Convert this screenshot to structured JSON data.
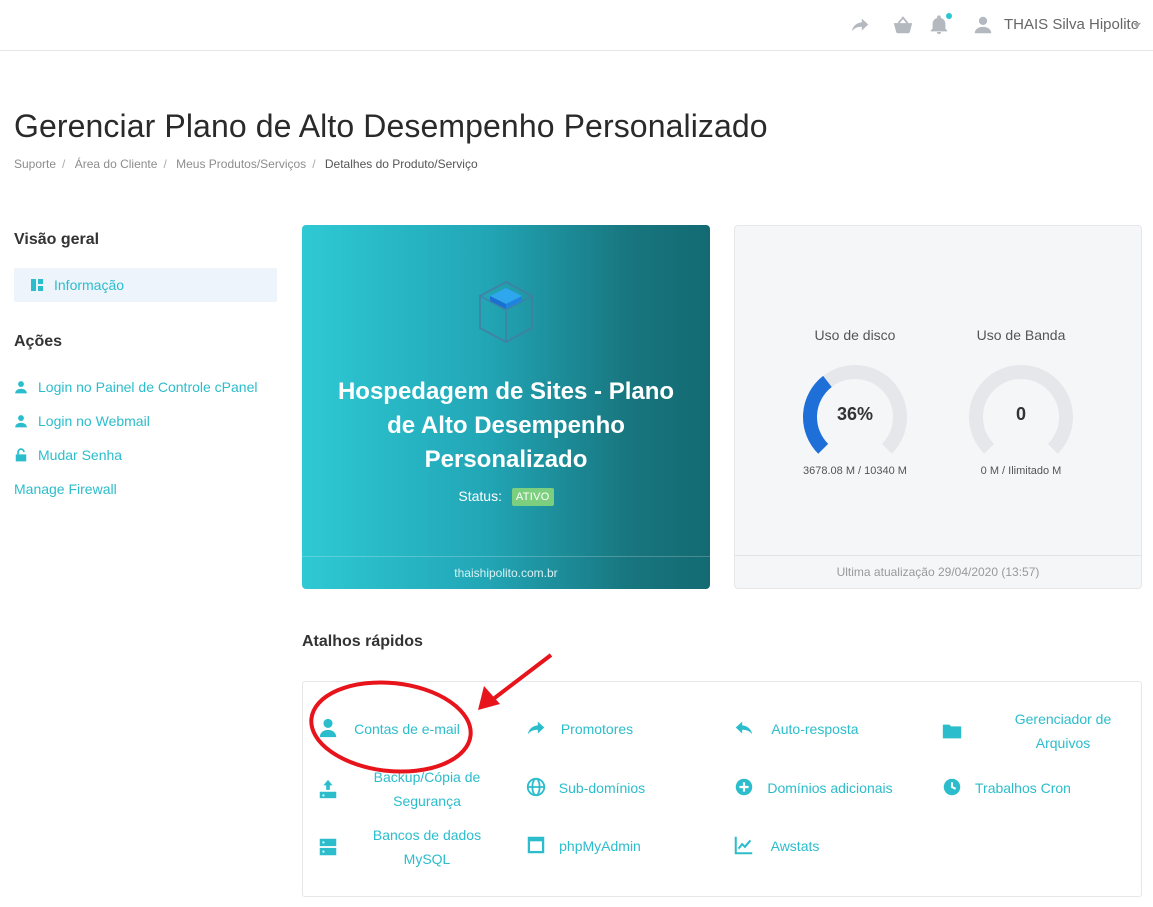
{
  "topbar": {
    "icons": [
      "share-icon",
      "basket-icon",
      "bell-icon",
      "user-icon"
    ],
    "user_name": "THAIS Silva Hipolito"
  },
  "header": {
    "title": "Gerenciar Plano de Alto Desempenho Personalizado",
    "breadcrumb": [
      "Suporte",
      "Área do Cliente",
      "Meus Produtos/Serviços",
      "Detalhes do Produto/Serviço"
    ]
  },
  "sidebar": {
    "overview_heading": "Visão geral",
    "overview_items": [
      {
        "label": "Informação",
        "icon": "dashboard-icon"
      }
    ],
    "actions_heading": "Ações",
    "actions": [
      {
        "label": "Login no Painel de Controle cPanel",
        "icon": "user-icon"
      },
      {
        "label": "Login no Webmail",
        "icon": "user-icon"
      },
      {
        "label": "Mudar Senha",
        "icon": "lock-icon"
      },
      {
        "label": "Manage Firewall",
        "icon": ""
      }
    ]
  },
  "product": {
    "icon": "cube-icon",
    "name": "Hospedagem de Sites - Plano de Alto Desempenho Personalizado",
    "status_label": "Status:",
    "status_value": "ATIVO",
    "domain": "thaishipolito.com.br"
  },
  "usage": {
    "disk": {
      "label": "Uso de disco",
      "value_text": "36%",
      "percent": 36,
      "detail": "3678.08 M / 10340 M"
    },
    "bandwidth": {
      "label": "Uso de Banda",
      "value_text": "0",
      "percent": 0,
      "detail": "0 M / Ilimitado M"
    },
    "last_update": "Ultima atualização 29/04/2020 (13:57)"
  },
  "shortcuts": {
    "title": "Atalhos rápidos",
    "items": [
      {
        "label": "Contas de e-mail",
        "icon": "user-icon"
      },
      {
        "label": "Promotores",
        "icon": "forward-icon"
      },
      {
        "label": "Auto-resposta",
        "icon": "reply-icon"
      },
      {
        "label": "Gerenciador de Arquivos",
        "icon": "folder-icon"
      },
      {
        "label": "Backup/Cópia de Segurança",
        "icon": "upload-icon"
      },
      {
        "label": "Sub-domínios",
        "icon": "globe-icon"
      },
      {
        "label": "Domínios adicionais",
        "icon": "plus-circle-icon"
      },
      {
        "label": "Trabalhos Cron",
        "icon": "clock-icon"
      },
      {
        "label": "Bancos de dados MySQL",
        "icon": "database-icon"
      },
      {
        "label": "phpMyAdmin",
        "icon": "window-icon"
      },
      {
        "label": "Awstats",
        "icon": "chart-line-icon"
      }
    ]
  },
  "colors": {
    "accent": "#2bbdcc",
    "badge": "#7ccf7e",
    "annotation": "#e8141b",
    "gauge_fill": "#1f6fd8",
    "gauge_track": "#e5e7ea"
  }
}
